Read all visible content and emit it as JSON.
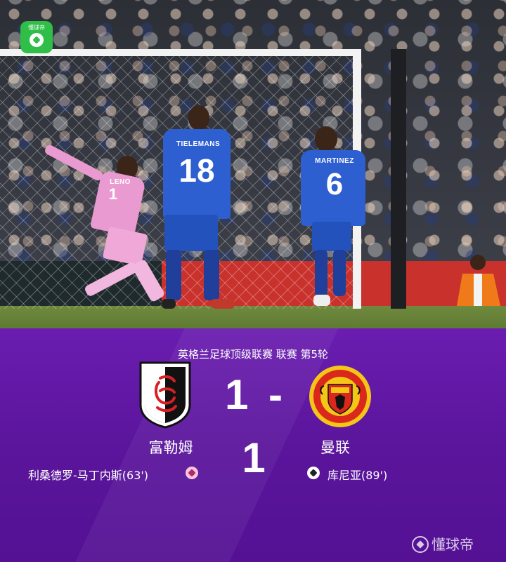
{
  "app": {
    "logo_text": "懂球帝",
    "watermark": "懂球帝"
  },
  "photo": {
    "goalkeeper": {
      "number": "1",
      "name": "LENO"
    },
    "player_left": {
      "number": "18",
      "name": "TIELEMANS"
    },
    "player_right": {
      "number": "6",
      "name": "MARTINEZ"
    }
  },
  "match": {
    "competition": "英格兰足球顶级联赛 联赛 第5轮",
    "score": "1 - 1",
    "home": {
      "name": "富勒姆",
      "scorer": "利桑德罗-马丁内斯(63')",
      "color": "#ffffff"
    },
    "away": {
      "name": "曼联",
      "scorer": "库尼亚(89')",
      "color": "#da291c"
    }
  },
  "colors": {
    "panel": "#5b159c",
    "app_green": "#2fbf48"
  }
}
